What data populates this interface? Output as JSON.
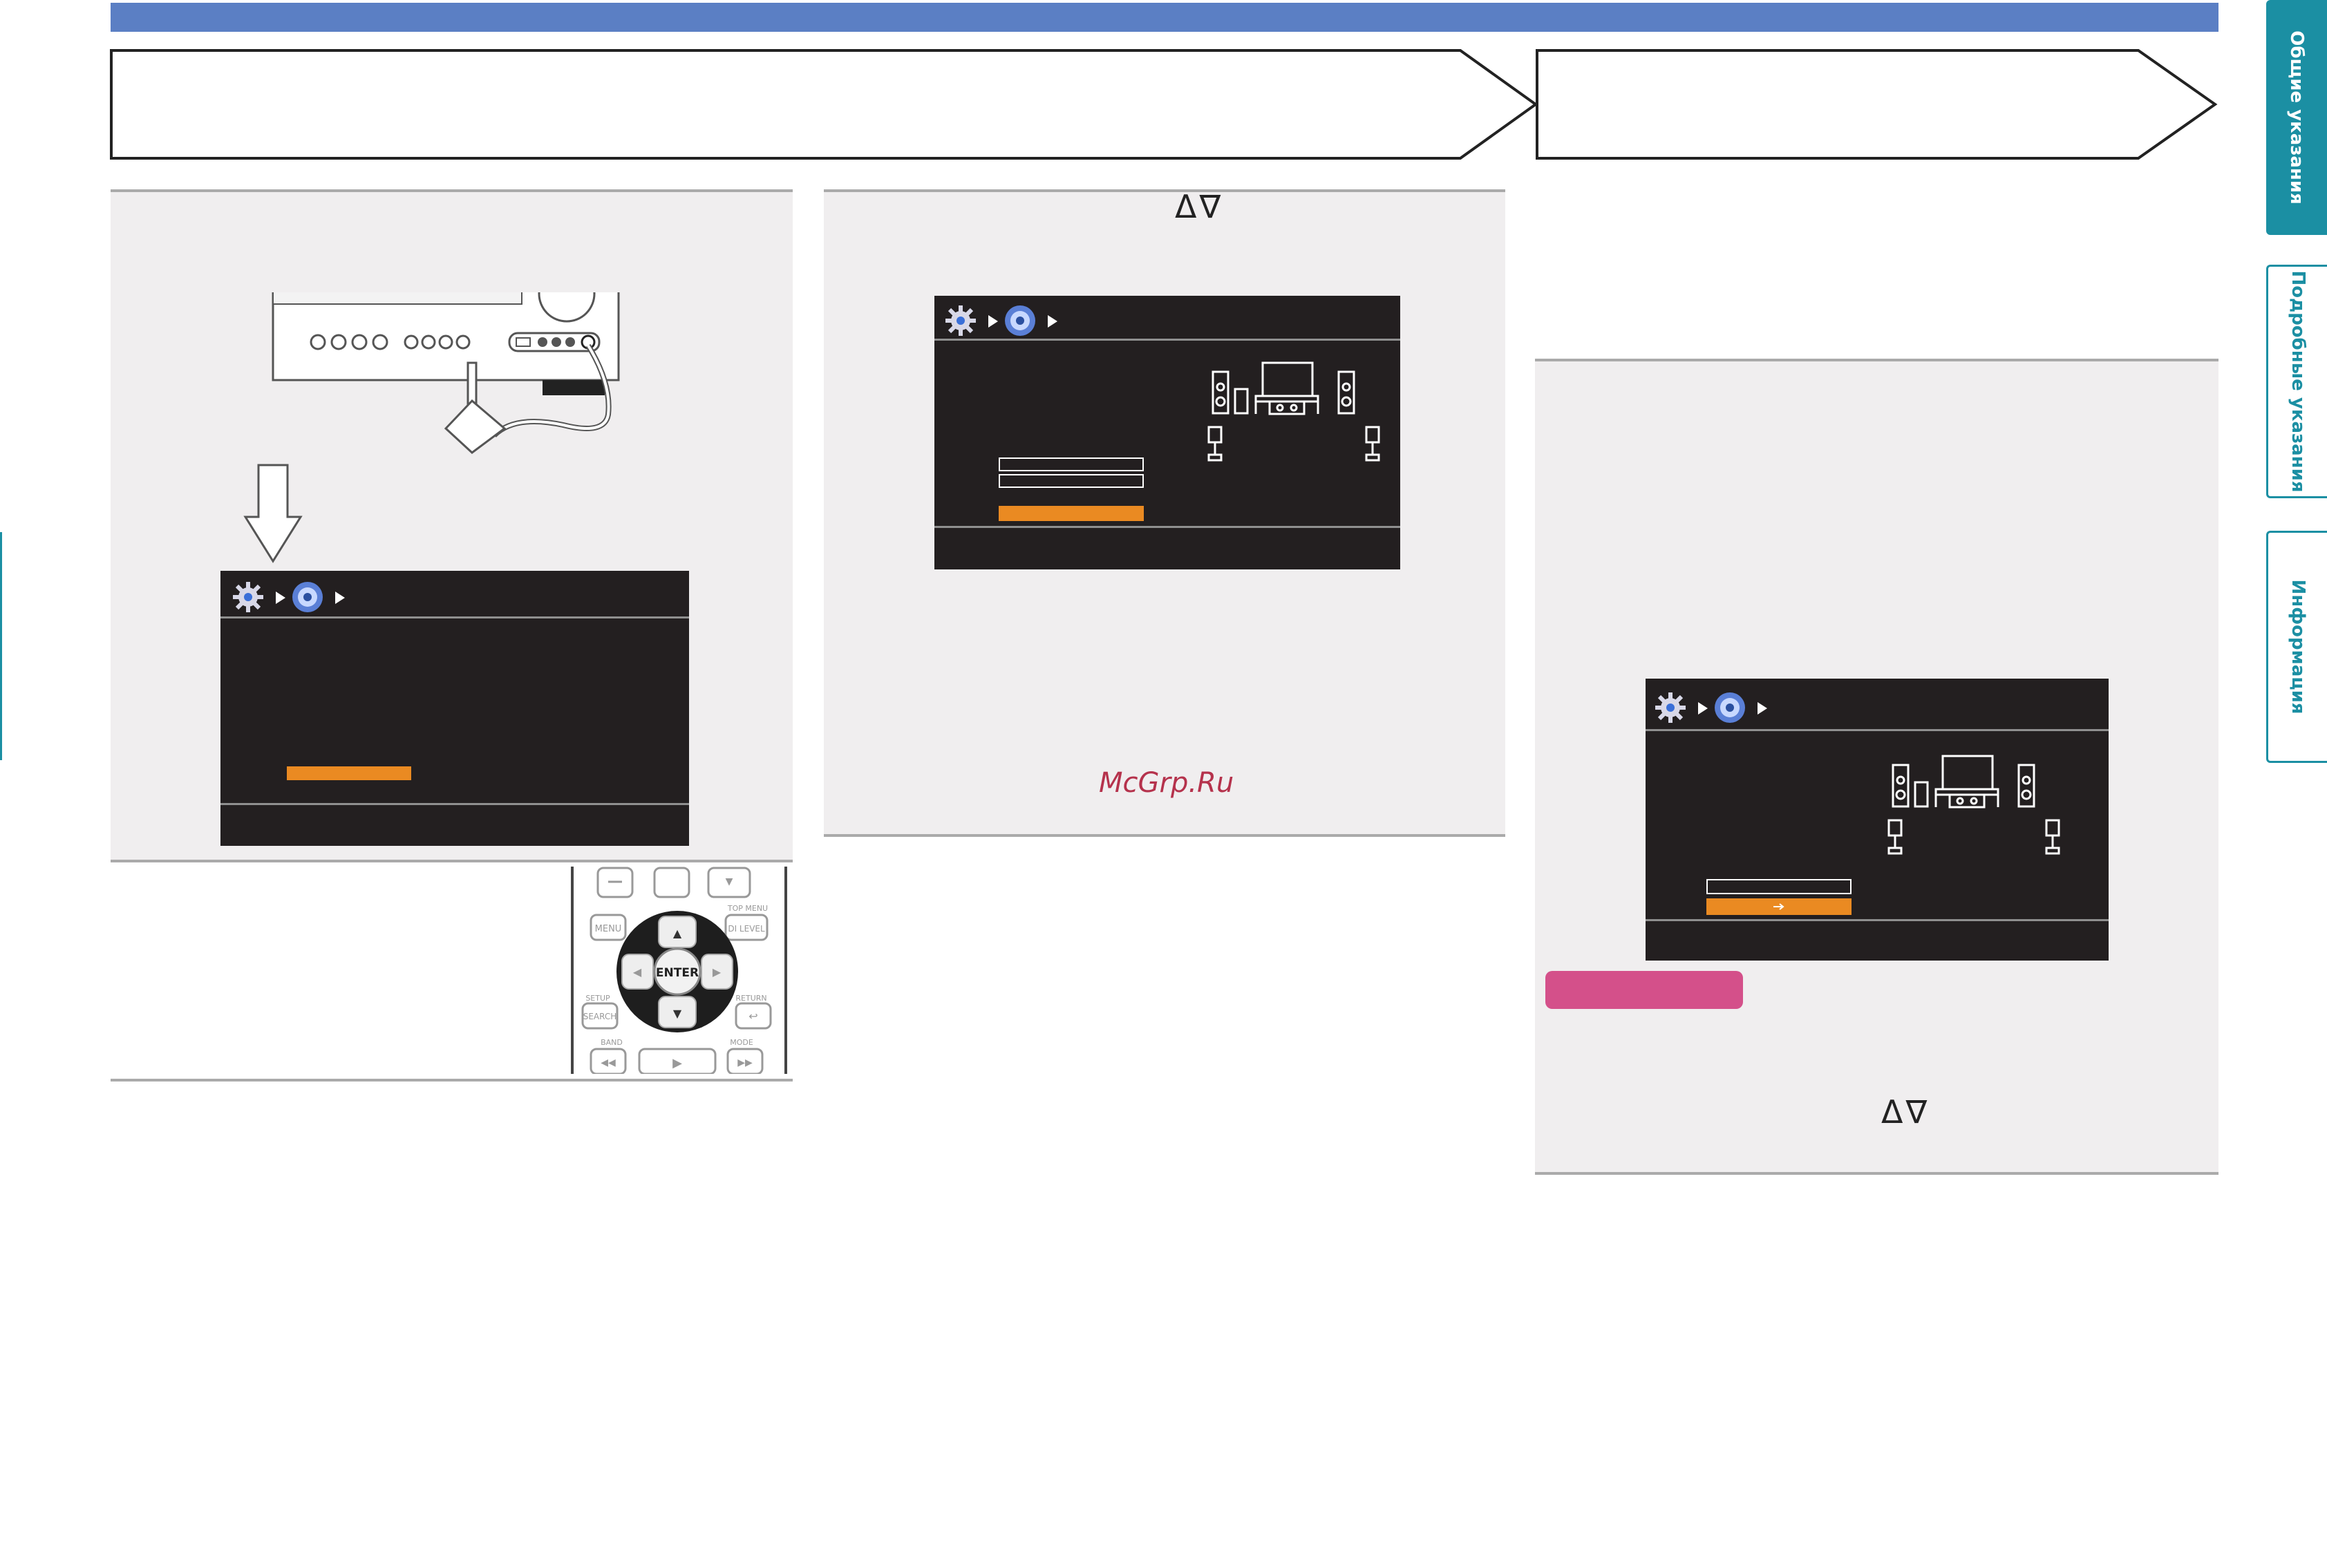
{
  "side_tabs": [
    {
      "label": "Общие указания",
      "active": true
    },
    {
      "label": "Подробные указания",
      "active": false
    },
    {
      "label": "Информация",
      "active": false
    }
  ],
  "step_arrows": "Δ∇",
  "enter_label": "ENTER",
  "watermark": "McGrp.Ru",
  "remote_labels": {
    "menu": "MENU",
    "dlevel": "DI LEVEL",
    "top_menu": "TOP MENU",
    "setup": "SETUP",
    "search": "SEARCH",
    "return": "RETURN",
    "band": "BAND",
    "mode": "MODE"
  },
  "colors": {
    "top_bar": "#5b7fc4",
    "active_tab": "#1b8fa3",
    "screen_bg": "#231f20",
    "highlight": "#ea8a22",
    "note_label": "#d4508a",
    "watermark": "#b5324c"
  }
}
